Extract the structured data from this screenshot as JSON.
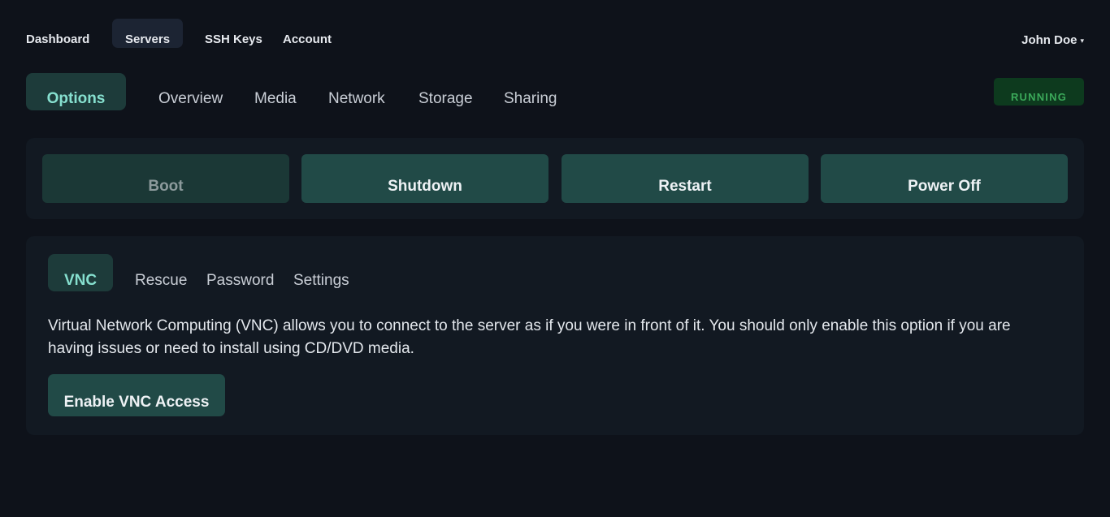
{
  "topnav": {
    "items": [
      {
        "label": "Dashboard"
      },
      {
        "label": "Servers",
        "active": true
      },
      {
        "label": "SSH Keys"
      },
      {
        "label": "Account"
      }
    ],
    "user": {
      "name": "John Doe",
      "caret": "▾"
    }
  },
  "subtabs": {
    "items": [
      {
        "label": "Options",
        "active": true
      },
      {
        "label": "Overview"
      },
      {
        "label": "Media"
      },
      {
        "label": "Network"
      },
      {
        "label": "Storage"
      },
      {
        "label": "Sharing"
      }
    ]
  },
  "status": {
    "label": "RUNNING",
    "color": "#3ba95a"
  },
  "power": {
    "buttons": [
      {
        "label": "Boot",
        "disabled": true
      },
      {
        "label": "Shutdown"
      },
      {
        "label": "Restart"
      },
      {
        "label": "Power Off"
      }
    ]
  },
  "vnc": {
    "tabs": [
      {
        "label": "VNC",
        "active": true
      },
      {
        "label": "Rescue"
      },
      {
        "label": "Password"
      },
      {
        "label": "Settings"
      }
    ],
    "description": "Virtual Network Computing (VNC) allows you to connect to the server as if you were in front of it. You should only enable this option if you are having issues or need to install using CD/DVD media.",
    "enable_label": "Enable VNC Access"
  },
  "colors": {
    "background": "#0e121a",
    "panel": "#121922",
    "accent": "#214a47",
    "accent_text": "#86e0cf"
  }
}
